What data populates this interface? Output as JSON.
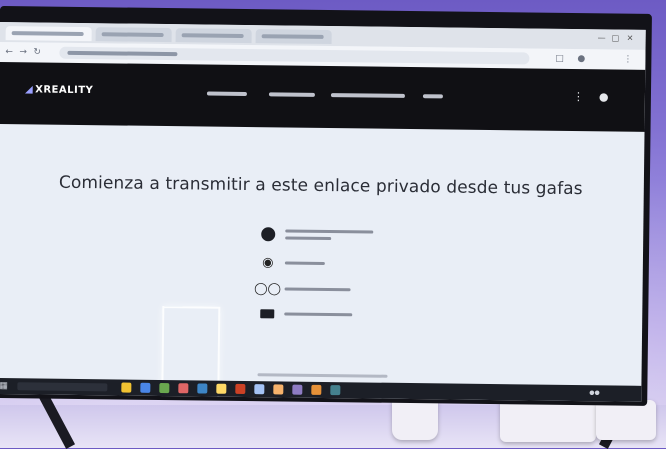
{
  "screen": {
    "heading": "Comienza a transmitir a este enlace privado desde tus gafas",
    "site_logo": "XREALITY",
    "step_icons": [
      "circle-icon",
      "camera-icon",
      "glasses-icon",
      "screen-icon"
    ],
    "taskbar_app_colors": [
      "#f1c232",
      "#4a86e8",
      "#6aa84f",
      "#e06666",
      "#3d85c6",
      "#ffd966",
      "#cc4125",
      "#a4c2f4",
      "#f6b26b",
      "#8e7cc3",
      "#e69138",
      "#45818e"
    ]
  }
}
